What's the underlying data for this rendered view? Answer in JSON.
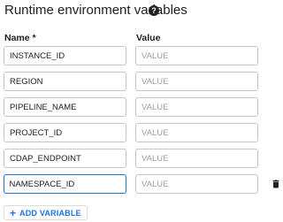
{
  "section": {
    "title": "Runtime environment variables",
    "help_icon_glyph": "?"
  },
  "columns": {
    "name_header": "Name *",
    "value_header": "Value"
  },
  "value_placeholder": "VALUE",
  "variables": [
    {
      "name": "INSTANCE_ID",
      "value": ""
    },
    {
      "name": "REGION",
      "value": ""
    },
    {
      "name": "PIPELINE_NAME",
      "value": ""
    },
    {
      "name": "PROJECT_ID",
      "value": ""
    },
    {
      "name": "CDAP_ENDPOINT",
      "value": ""
    },
    {
      "name": "NAMESPACE_ID",
      "value": ""
    }
  ],
  "focused_row_index": 5,
  "add_button": {
    "icon": "+",
    "label": "ADD VARIABLE"
  },
  "colors": {
    "accent": "#1a73e8",
    "border": "#c4c7c5",
    "text": "#202124",
    "placeholder": "#9aa0a6"
  }
}
